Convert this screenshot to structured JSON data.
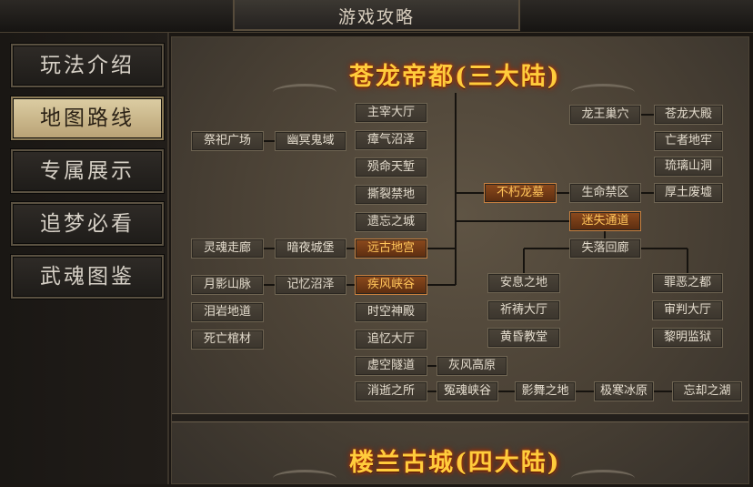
{
  "window": {
    "title": "游戏攻略"
  },
  "sidebar": {
    "items": [
      {
        "label": "玩法介绍",
        "active": false
      },
      {
        "label": "地图路线",
        "active": true
      },
      {
        "label": "专属展示",
        "active": false
      },
      {
        "label": "追梦必看",
        "active": false
      },
      {
        "label": "武魂图鉴",
        "active": false
      }
    ]
  },
  "map": {
    "section1_title": "苍龙帝都(三大陆)",
    "section2_title": "楼兰古城(四大陆)",
    "locations": [
      {
        "id": "n1",
        "label": "主宰大厅",
        "highlight": false
      },
      {
        "id": "n2",
        "label": "瘴气沼泽",
        "highlight": false
      },
      {
        "id": "n3",
        "label": "殒命天堑",
        "highlight": false
      },
      {
        "id": "n4",
        "label": "撕裂禁地",
        "highlight": false
      },
      {
        "id": "n5",
        "label": "遗忘之城",
        "highlight": false
      },
      {
        "id": "n6",
        "label": "远古地宫",
        "highlight": true
      },
      {
        "id": "n7",
        "label": "疾风峡谷",
        "highlight": true
      },
      {
        "id": "n8",
        "label": "时空神殿",
        "highlight": false
      },
      {
        "id": "n9",
        "label": "追忆大厅",
        "highlight": false
      },
      {
        "id": "n10",
        "label": "虚空隧道",
        "highlight": false
      },
      {
        "id": "n11",
        "label": "消逝之所",
        "highlight": false
      },
      {
        "id": "n12",
        "label": "祭祀广场",
        "highlight": false
      },
      {
        "id": "n13",
        "label": "幽冥鬼域",
        "highlight": false
      },
      {
        "id": "n14",
        "label": "灵魂走廊",
        "highlight": false
      },
      {
        "id": "n15",
        "label": "暗夜城堡",
        "highlight": false
      },
      {
        "id": "n16",
        "label": "月影山脉",
        "highlight": false
      },
      {
        "id": "n17",
        "label": "记忆沼泽",
        "highlight": false
      },
      {
        "id": "n18",
        "label": "泪岩地道",
        "highlight": false
      },
      {
        "id": "n19",
        "label": "死亡棺材",
        "highlight": false
      },
      {
        "id": "n20",
        "label": "灰风高原",
        "highlight": false
      },
      {
        "id": "n21",
        "label": "冤魂峡谷",
        "highlight": false
      },
      {
        "id": "n22",
        "label": "影舞之地",
        "highlight": false
      },
      {
        "id": "n23",
        "label": "极寒冰原",
        "highlight": false
      },
      {
        "id": "n24",
        "label": "忘却之湖",
        "highlight": false
      },
      {
        "id": "n25",
        "label": "不朽龙墓",
        "highlight": true
      },
      {
        "id": "n26",
        "label": "生命禁区",
        "highlight": false
      },
      {
        "id": "n27",
        "label": "龙王巢穴",
        "highlight": false
      },
      {
        "id": "n28",
        "label": "苍龙大殿",
        "highlight": false
      },
      {
        "id": "n29",
        "label": "亡者地牢",
        "highlight": false
      },
      {
        "id": "n30",
        "label": "琉璃山洞",
        "highlight": false
      },
      {
        "id": "n31",
        "label": "厚土废墟",
        "highlight": false
      },
      {
        "id": "n32",
        "label": "迷失通道",
        "highlight": true
      },
      {
        "id": "n33",
        "label": "失落回廊",
        "highlight": false
      },
      {
        "id": "n34",
        "label": "安息之地",
        "highlight": false
      },
      {
        "id": "n35",
        "label": "祈祷大厅",
        "highlight": false
      },
      {
        "id": "n36",
        "label": "黄昏教堂",
        "highlight": false
      },
      {
        "id": "n37",
        "label": "罪恶之都",
        "highlight": false
      },
      {
        "id": "n38",
        "label": "审判大厅",
        "highlight": false
      },
      {
        "id": "n39",
        "label": "黎明监狱",
        "highlight": false
      }
    ]
  }
}
